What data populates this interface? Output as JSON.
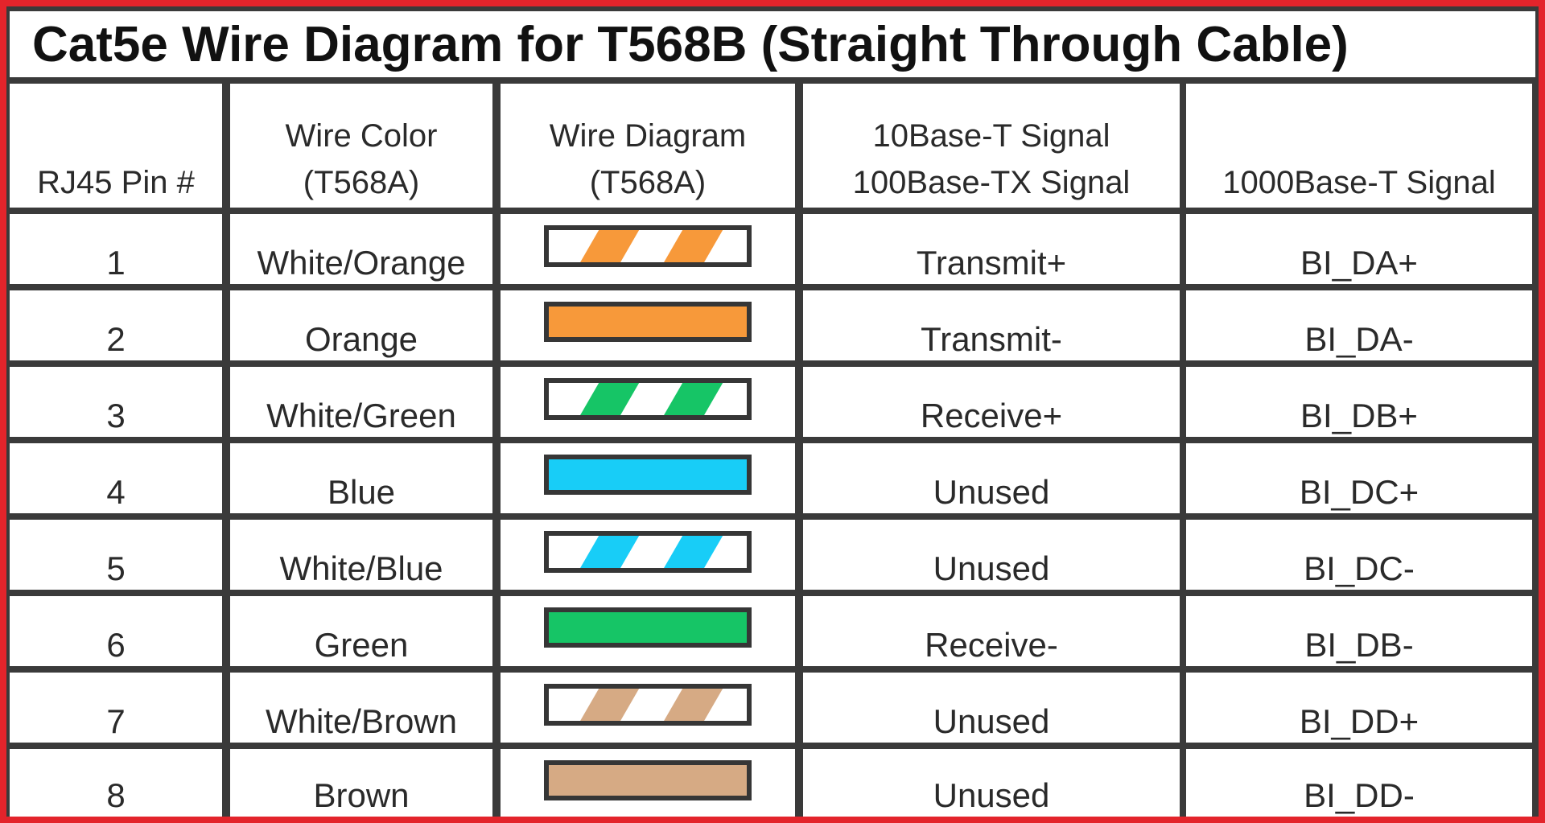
{
  "title": "Cat5e Wire Diagram for T568B (Straight Through Cable)",
  "headers": {
    "pin": "RJ45 Pin #",
    "wire_color_1": "Wire Color",
    "wire_color_2": "(T568A)",
    "wire_diagram_1": "Wire Diagram",
    "wire_diagram_2": "(T568A)",
    "signal_10_100_1": "10Base-T Signal",
    "signal_10_100_2": "100Base-TX Signal",
    "signal_1000": "1000Base-T Signal"
  },
  "rows": [
    {
      "pin": "1",
      "color": "White/Orange",
      "pattern": "striped",
      "hex": "#f7993a",
      "signal_10_100": "Transmit+",
      "signal_1000": "BI_DA+"
    },
    {
      "pin": "2",
      "color": "Orange",
      "pattern": "solid",
      "hex": "#f7993a",
      "signal_10_100": "Transmit-",
      "signal_1000": "BI_DA-"
    },
    {
      "pin": "3",
      "color": "White/Green",
      "pattern": "striped",
      "hex": "#16c566",
      "signal_10_100": "Receive+",
      "signal_1000": "BI_DB+"
    },
    {
      "pin": "4",
      "color": "Blue",
      "pattern": "solid",
      "hex": "#18cdf7",
      "signal_10_100": "Unused",
      "signal_1000": "BI_DC+"
    },
    {
      "pin": "5",
      "color": "White/Blue",
      "pattern": "striped",
      "hex": "#18cdf7",
      "signal_10_100": "Unused",
      "signal_1000": "BI_DC-"
    },
    {
      "pin": "6",
      "color": "Green",
      "pattern": "solid",
      "hex": "#16c566",
      "signal_10_100": "Receive-",
      "signal_1000": "BI_DB-"
    },
    {
      "pin": "7",
      "color": "White/Brown",
      "pattern": "striped",
      "hex": "#d6aa84",
      "signal_10_100": "Unused",
      "signal_1000": "BI_DD+"
    },
    {
      "pin": "8",
      "color": "Brown",
      "pattern": "solid",
      "hex": "#d6aa84",
      "signal_10_100": "Unused",
      "signal_1000": "BI_DD-"
    }
  ]
}
